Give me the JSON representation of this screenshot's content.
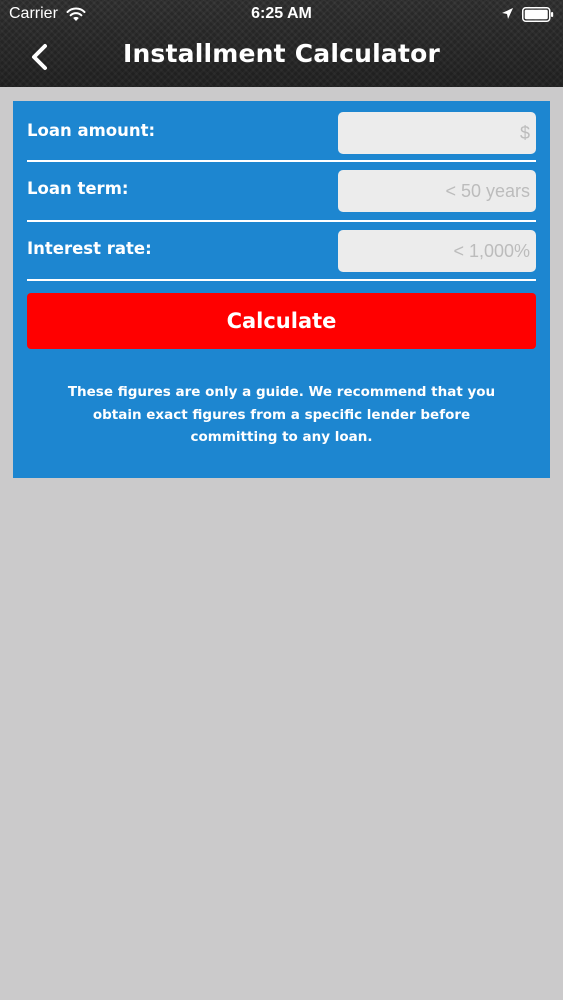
{
  "status_bar": {
    "carrier": "Carrier",
    "time": "6:25 AM",
    "icons": [
      "wifi-icon",
      "location-icon",
      "battery-icon"
    ]
  },
  "nav": {
    "back_icon": "chevron-left-icon",
    "title": "Installment Calculator"
  },
  "form": {
    "loan_amount": {
      "label": "Loan amount:",
      "value": "",
      "placeholder": "$"
    },
    "loan_term": {
      "label": "Loan term:",
      "value": "",
      "placeholder": "< 50 years"
    },
    "interest_rate": {
      "label": "Interest rate:",
      "value": "",
      "placeholder": "< 1,000%"
    }
  },
  "calculate_label": "Calculate",
  "disclaimer": "These figures are only a guide. We recommend that you obtain exact figures from a specific lender before committing to any loan.",
  "colors": {
    "panel": "#1d86d0",
    "button": "#ff0000",
    "background": "#cbcacb",
    "navbar": "#2f2f2f"
  }
}
